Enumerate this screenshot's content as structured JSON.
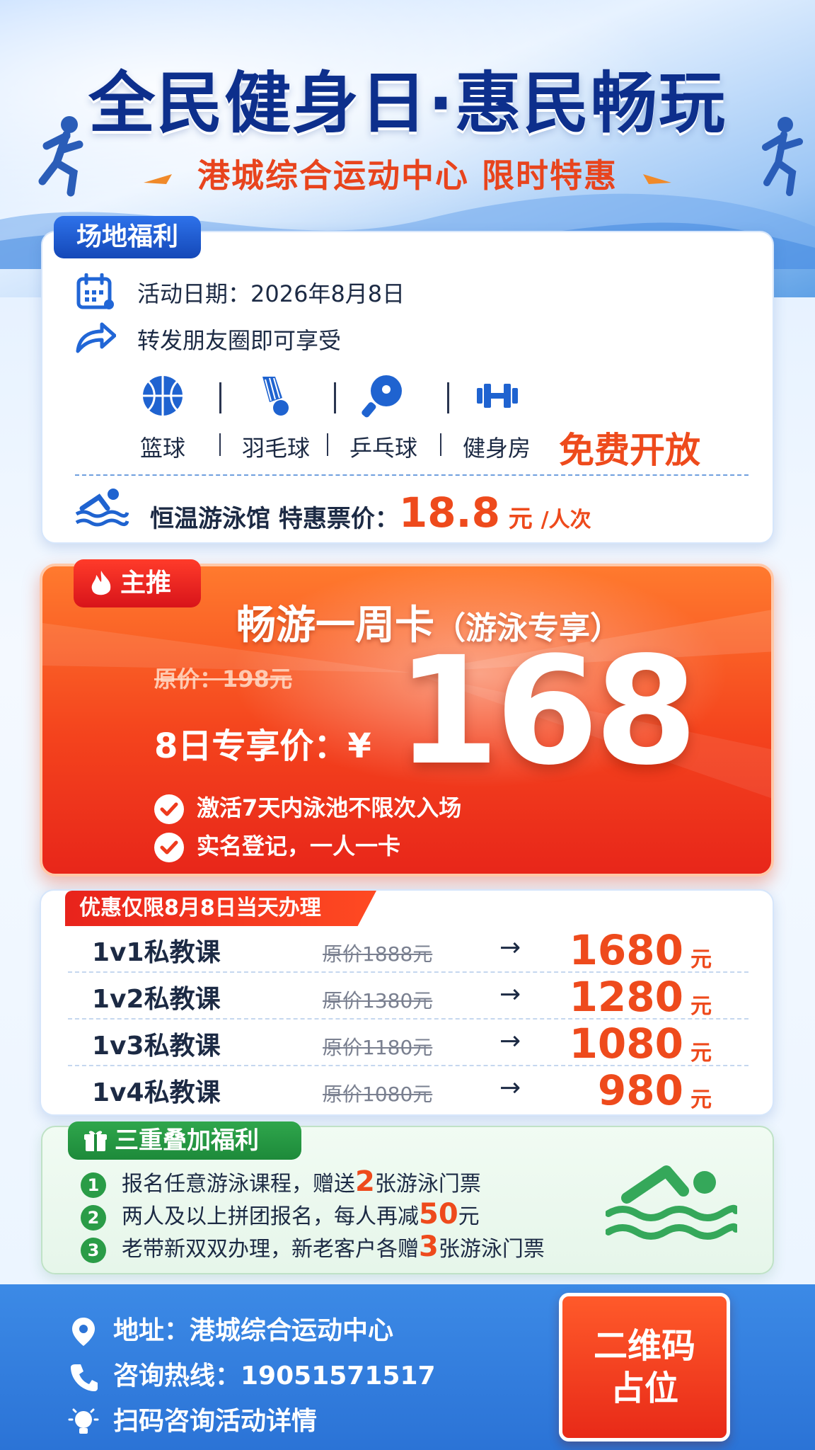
{
  "hero": {
    "title": "全民健身日·惠民畅玩",
    "subtitle": "港城综合运动中心  限时特惠"
  },
  "venue": {
    "tab": "场地福利",
    "date": "活动日期：2026年8月8日",
    "share": "转发朋友圈即可享受",
    "sports": [
      {
        "label": "篮球",
        "icon": "basketball-icon"
      },
      {
        "label": "羽毛球",
        "icon": "badminton-icon"
      },
      {
        "label": "乒乓球",
        "icon": "ping-pong-icon"
      },
      {
        "label": "健身房",
        "icon": "dumbbell-icon"
      }
    ],
    "free_label": "免费开放",
    "swim_label": "恒温游泳馆 特惠票价：",
    "swim_price": "18.8",
    "swim_unit": "元",
    "swim_per": "/人次"
  },
  "featured": {
    "tag": "主推",
    "title": "畅游一周卡",
    "title_suffix": "（游泳专享）",
    "original_price": "原价：198元",
    "deal_label": "8日专享价：¥",
    "price": "168",
    "features": [
      "激活7天内泳池不限次入场",
      "实名登记，一人一卡"
    ]
  },
  "lessons": {
    "tag": "优惠仅限8月8日当天办理",
    "rows": [
      {
        "name": "1v1私教课",
        "old": "原价1888元",
        "new": "1680",
        "unit": "元"
      },
      {
        "name": "1v2私教课",
        "old": "原价1380元",
        "new": "1280",
        "unit": "元"
      },
      {
        "name": "1v3私教课",
        "old": "原价1180元",
        "new": "1080",
        "unit": "元"
      },
      {
        "name": "1v4私教课",
        "old": "原价1080元",
        "new": "980",
        "unit": "元"
      }
    ],
    "arrow": "→"
  },
  "bonus": {
    "tag": "三重叠加福利",
    "items": [
      {
        "n": "1",
        "pre": "报名任意游泳课程，赠送",
        "hl": "2",
        "post": "张游泳门票"
      },
      {
        "n": "2",
        "pre": "两人及以上拼团报名，每人再减",
        "hl": "50",
        "post": "元"
      },
      {
        "n": "3",
        "pre": "老带新双双办理，新老客户各赠",
        "hl": "3",
        "post": "张游泳门票"
      }
    ]
  },
  "footer": {
    "address": "地址：港城综合运动中心",
    "hotline": "咨询热线：19051571517",
    "scan": "扫码咨询活动详情",
    "qr_line1": "二维码",
    "qr_line2": "占位"
  },
  "colors": {
    "brand_blue": "#0d2f8c",
    "accent_red": "#ee4a1c",
    "green": "#2a9c47"
  }
}
